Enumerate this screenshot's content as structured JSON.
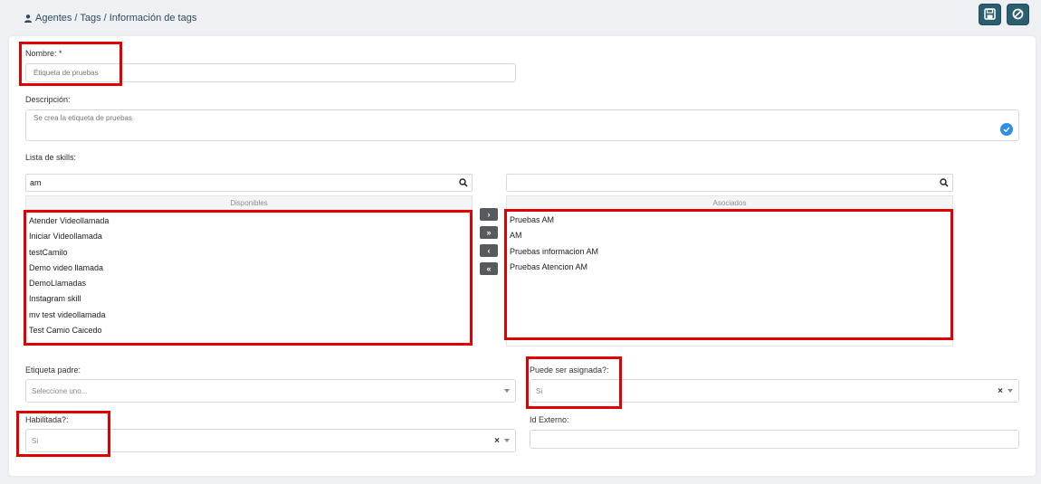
{
  "breadcrumb": {
    "text": "Agentes / Tags / Información de tags"
  },
  "form": {
    "nombre_label": "Nombre: *",
    "nombre_value": "Etiqueta de pruebas",
    "descripcion_label": "Descripción:",
    "descripcion_value": "Se crea la etiqueta de pruebas",
    "skills_label": "Lista de skills:",
    "disponibles": {
      "search_value": "am",
      "header": "Disponibles",
      "items": [
        "Atender Videollamada",
        "Iniciar Videollamada",
        "testCamilo",
        "Demo video llamada",
        "DemoLlamadas",
        "Instagram skill",
        "mv test videollamada",
        "Test Camio Caicedo"
      ]
    },
    "asociados": {
      "search_value": "",
      "header": "Asociados",
      "items": [
        "Pruebas AM",
        "AM",
        "Pruebas informacion AM",
        "Pruebas Atencion AM"
      ]
    },
    "move_buttons": [
      "›",
      "»",
      "‹",
      "«"
    ],
    "etiqueta_padre_label": "Etiqueta padre:",
    "etiqueta_padre_placeholder": "Seleccione uno...",
    "puede_ser_asignada_label": "Puede ser asignada?:",
    "puede_ser_asignada_value": "Si",
    "habilitada_label": "Habilitada?:",
    "habilitada_value": "Si",
    "id_externo_label": "Id Externo:",
    "id_externo_value": "",
    "clear_glyph": "×"
  },
  "colors": {
    "header_button": "#2b5f6f",
    "highlight": "#e00000",
    "check": "#2e8fe6"
  },
  "icons": [
    "user-icon",
    "save-icon",
    "cancel-icon",
    "search-icon",
    "check-icon"
  ]
}
